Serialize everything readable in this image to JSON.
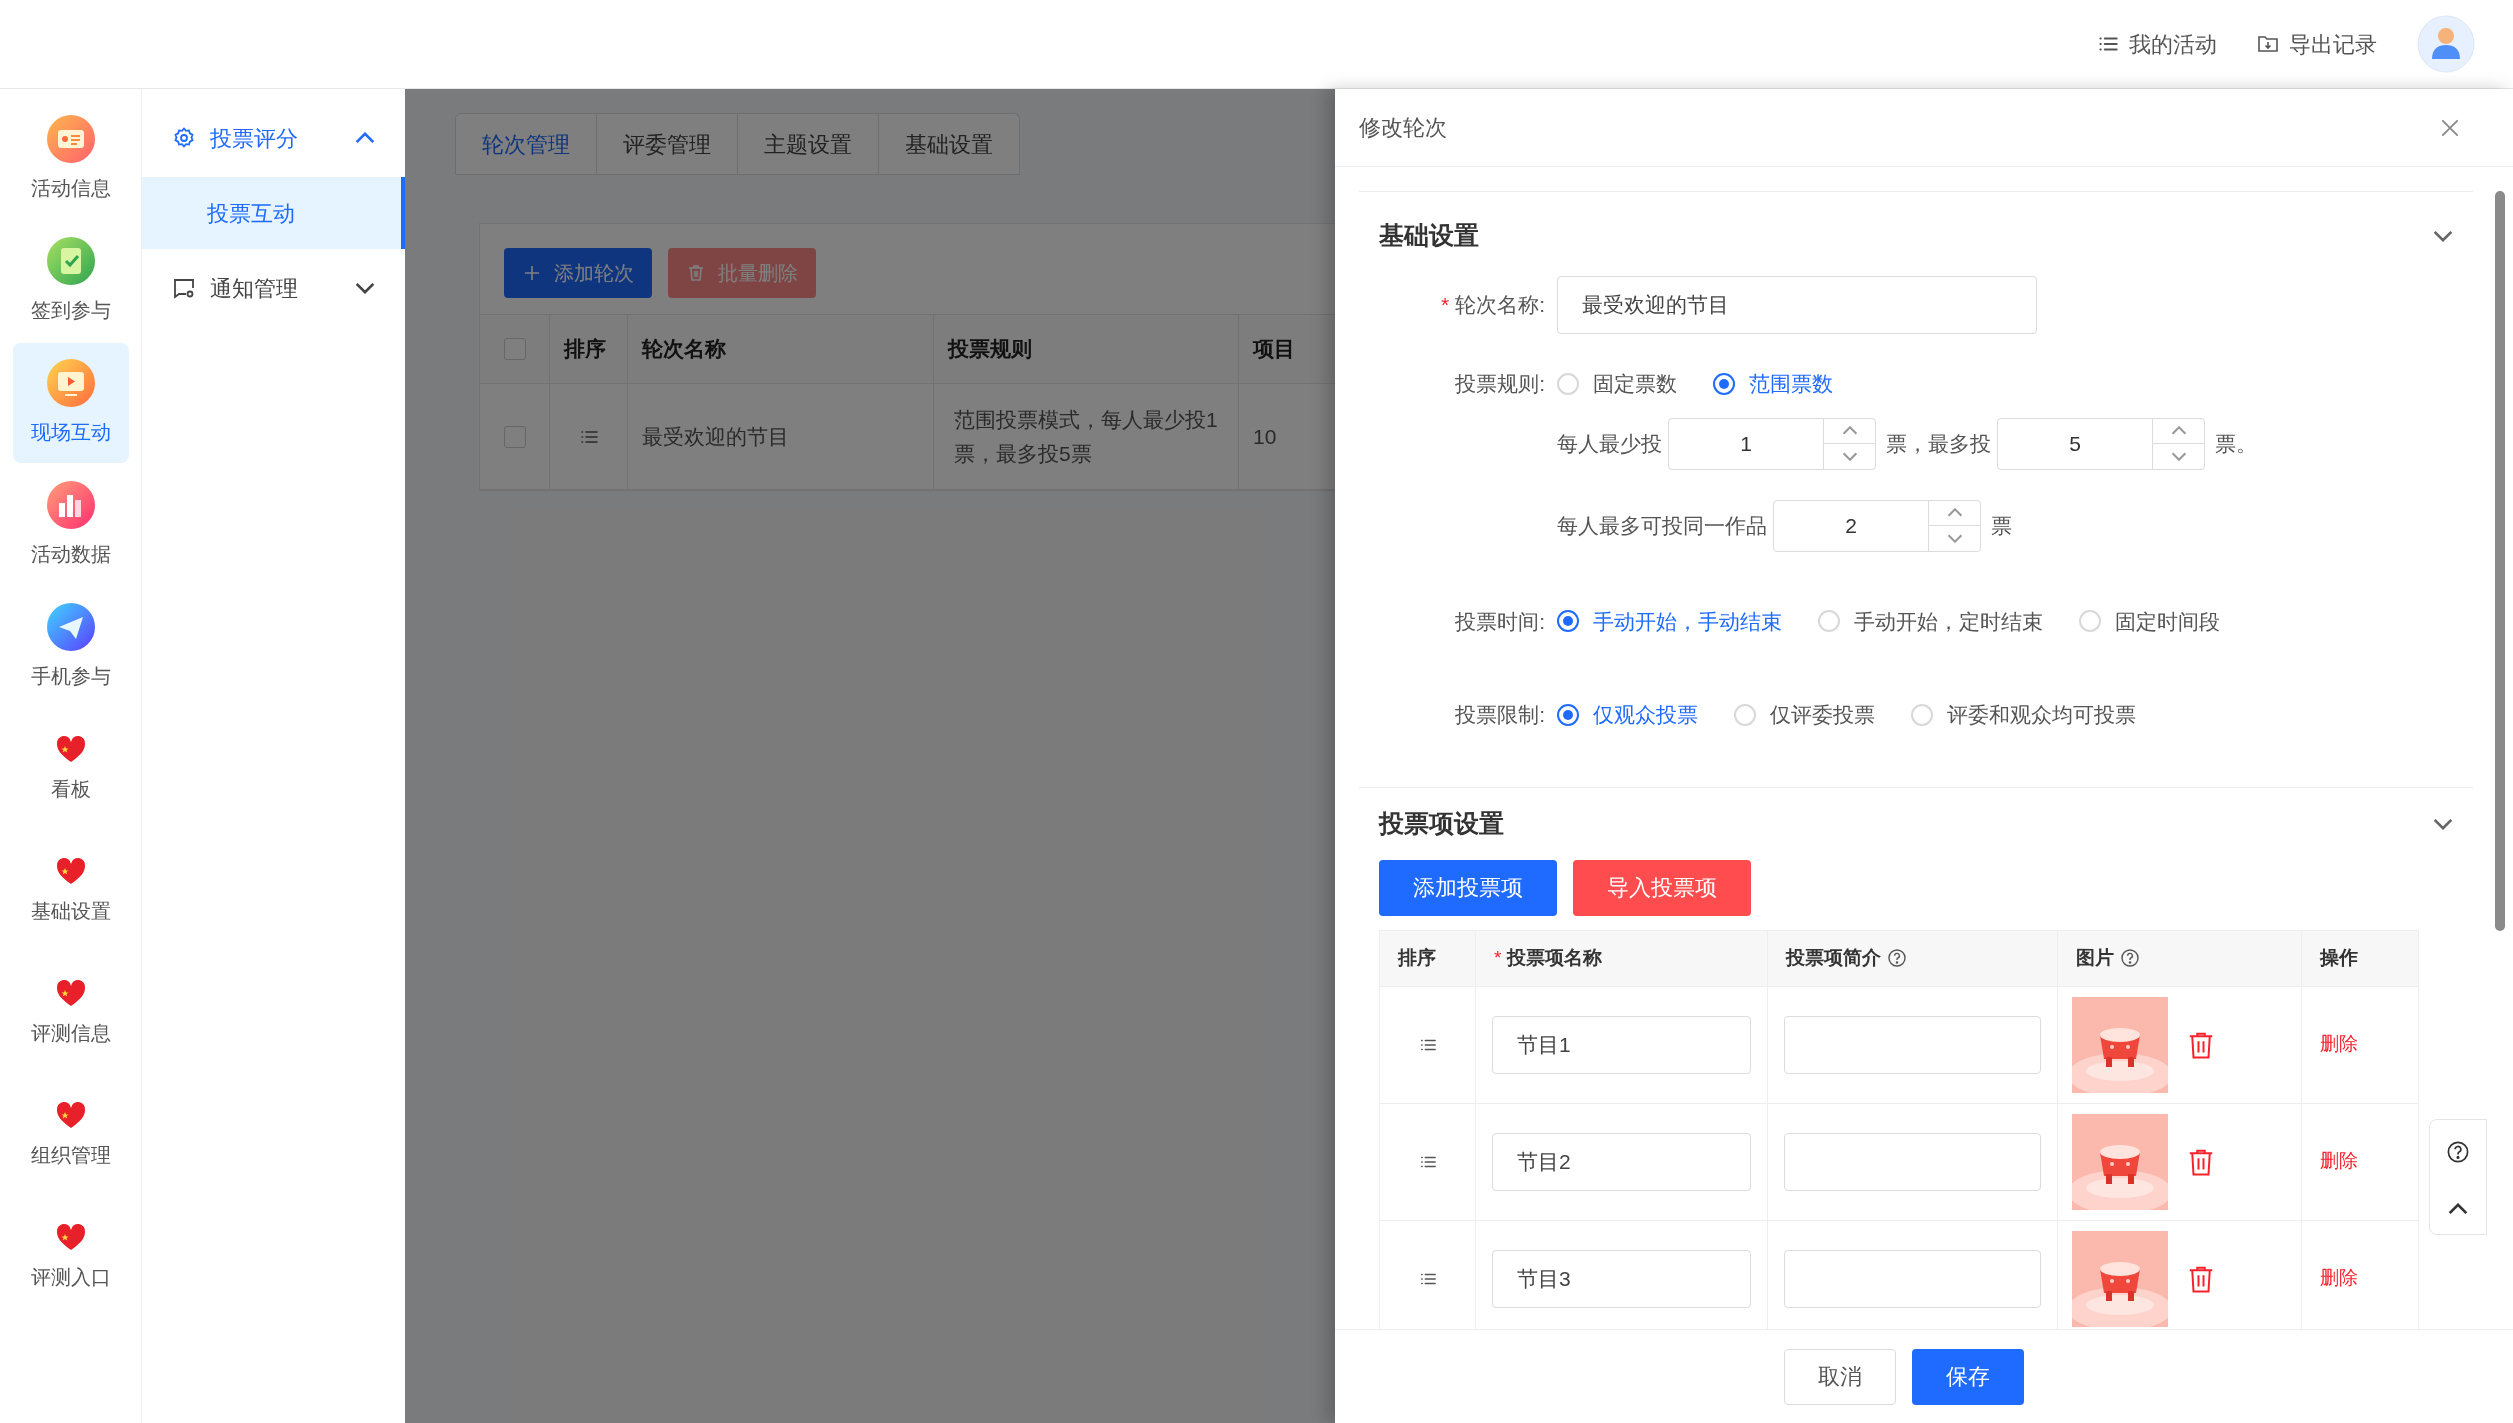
{
  "header": {
    "actions": [
      {
        "label": "我的活动"
      },
      {
        "label": "导出记录"
      }
    ]
  },
  "rail": [
    {
      "label": "活动信息",
      "selected": false
    },
    {
      "label": "签到参与",
      "selected": false
    },
    {
      "label": "现场互动",
      "selected": true
    },
    {
      "label": "活动数据",
      "selected": false
    },
    {
      "label": "手机参与",
      "selected": false
    },
    {
      "label": "看板",
      "selected": false
    },
    {
      "label": "基础设置",
      "selected": false
    },
    {
      "label": "评测信息",
      "selected": false
    },
    {
      "label": "组织管理",
      "selected": false
    },
    {
      "label": "评测入口",
      "selected": false
    }
  ],
  "submenu": [
    {
      "label": "投票评分",
      "expanded": true,
      "children": [
        {
          "label": "投票互动",
          "selected": true
        }
      ]
    },
    {
      "label": "通知管理",
      "expanded": false
    }
  ],
  "page": {
    "tabs": [
      {
        "label": "轮次管理",
        "selected": true
      },
      {
        "label": "评委管理",
        "selected": false
      },
      {
        "label": "主题设置",
        "selected": false
      },
      {
        "label": "基础设置",
        "selected": false
      }
    ],
    "toolbar": [
      {
        "label": "添加轮次",
        "kind": "primary"
      },
      {
        "label": "批量删除",
        "kind": "danger"
      }
    ],
    "table": {
      "all_checked": false,
      "columns": [
        "排序",
        "轮次名称",
        "投票规则",
        "项目"
      ],
      "rows": [
        {
          "checked": false,
          "name": "最受欢迎的节目",
          "rule": "范围投票模式，每人最少投1票，最多投5票",
          "count": "10"
        }
      ]
    }
  },
  "drawer": {
    "title": "修改轮次",
    "basic": {
      "title": "基础设置",
      "expanded": true,
      "name_field": {
        "required_mark": "*",
        "label": "轮次名称:",
        "value": "最受欢迎的节目"
      },
      "vote_rule": {
        "label": "投票规则:",
        "options": [
          {
            "label": "固定票数",
            "selected": false
          },
          {
            "label": "范围票数",
            "selected": true
          }
        ]
      },
      "range": {
        "min_label": "每人最少投",
        "min": "1",
        "mid_label": "票，最多投",
        "max": "5",
        "end_label": "票。"
      },
      "same_item": {
        "label": "每人最多可投同一作品",
        "value": "2",
        "unit": "票"
      },
      "vote_time": {
        "label": "投票时间:",
        "options": [
          {
            "label": "手动开始，手动结束",
            "selected": true
          },
          {
            "label": "手动开始，定时结束",
            "selected": false
          },
          {
            "label": "固定时间段",
            "selected": false
          }
        ]
      },
      "vote_limit": {
        "label": "投票限制:",
        "options": [
          {
            "label": "仅观众投票",
            "selected": true
          },
          {
            "label": "仅评委投票",
            "selected": false
          },
          {
            "label": "评委和观众均可投票",
            "selected": false
          }
        ]
      }
    },
    "items": {
      "title": "投票项设置",
      "expanded": true,
      "buttons": [
        {
          "label": "添加投票项",
          "kind": "primary"
        },
        {
          "label": "导入投票项",
          "kind": "danger"
        }
      ],
      "columns": [
        {
          "label": "排序",
          "help": false
        },
        {
          "required_mark": "*",
          "label": "投票项名称",
          "help": false
        },
        {
          "label": "投票项简介",
          "help": true
        },
        {
          "label": "图片",
          "help": true
        },
        {
          "label": "操作",
          "help": false
        }
      ],
      "rows": [
        {
          "name": "节目1",
          "action": "删除"
        },
        {
          "name": "节目2",
          "action": "删除"
        },
        {
          "name": "节目3",
          "action": "删除"
        }
      ]
    },
    "footer": [
      {
        "label": "取消",
        "kind": "default"
      },
      {
        "label": "保存",
        "kind": "primary"
      }
    ]
  }
}
